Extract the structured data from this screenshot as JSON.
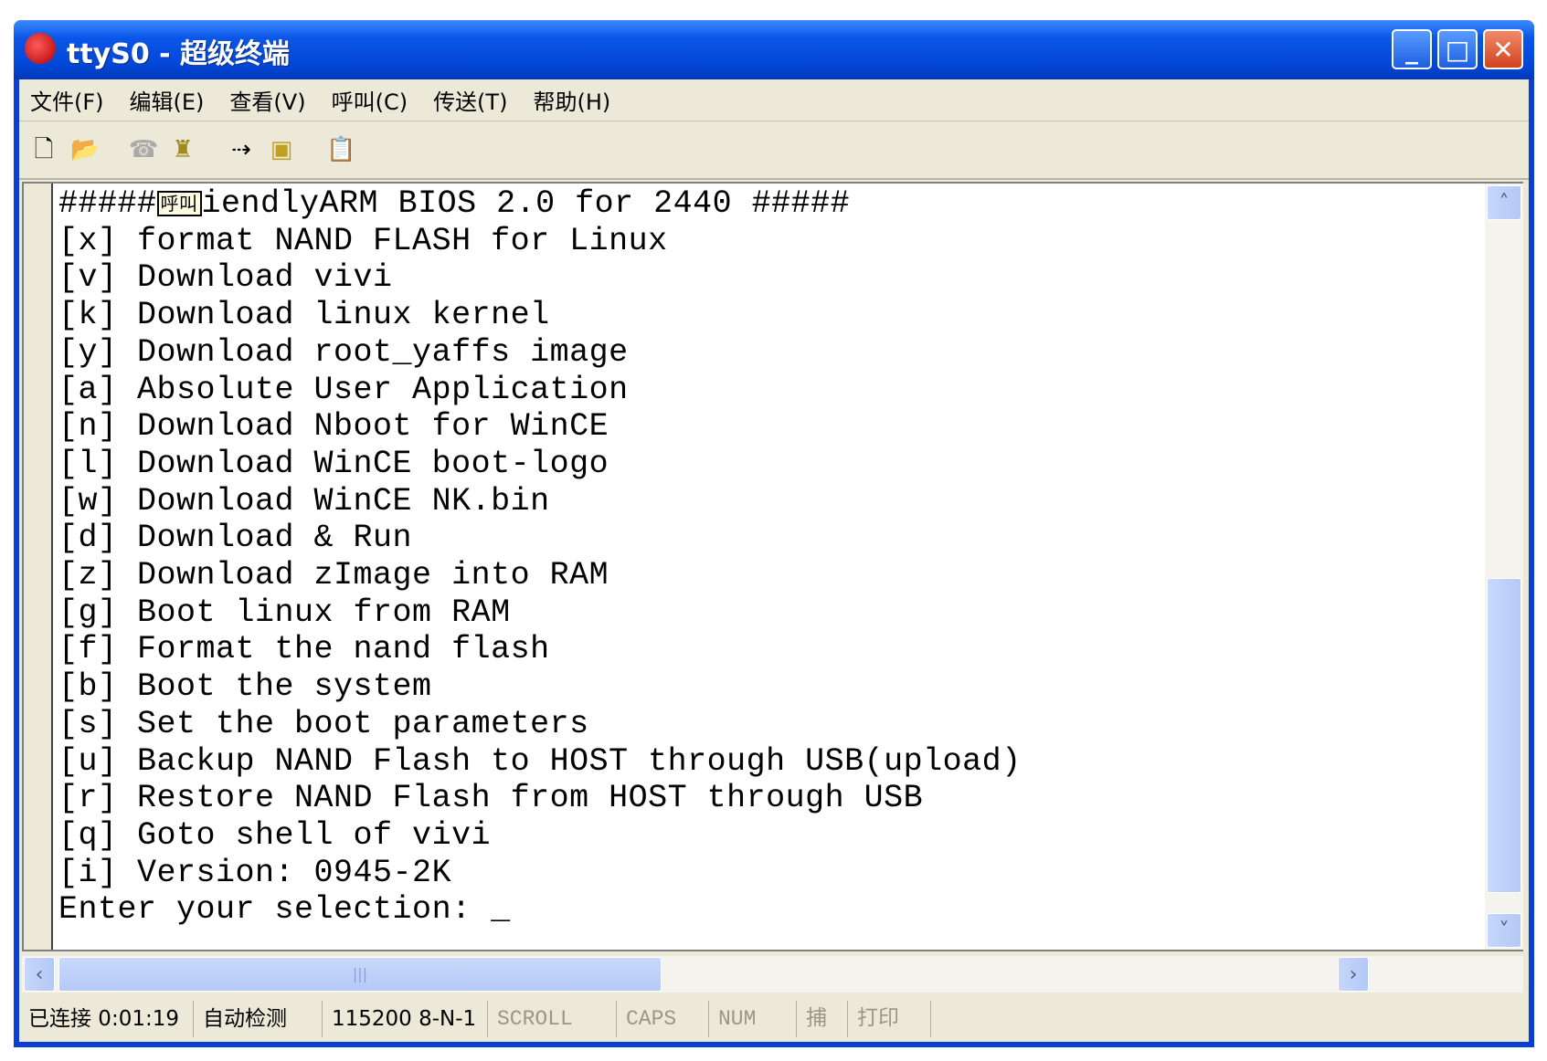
{
  "window": {
    "title": "ttyS0 - 超级终端"
  },
  "menu": [
    "文件(F)",
    "编辑(E)",
    "查看(V)",
    "呼叫(C)",
    "传送(T)",
    "帮助(H)"
  ],
  "toolbar": {
    "icons": [
      "new-file-icon",
      "open-folder-icon",
      "call-icon",
      "disconnect-icon",
      "send-icon",
      "receive-icon",
      "properties-icon"
    ]
  },
  "terminal": {
    "first_line_prefix": "#####",
    "overlay_label": "呼叫",
    "first_line_suffix": "iendlyARM BIOS 2.0 for 2440 #####",
    "lines": [
      "[x] format NAND FLASH for Linux",
      "[v] Download vivi",
      "[k] Download linux kernel",
      "[y] Download root_yaffs image",
      "[a] Absolute User Application",
      "[n] Download Nboot for WinCE",
      "[l] Download WinCE boot-logo",
      "[w] Download WinCE NK.bin",
      "[d] Download & Run",
      "[z] Download zImage into RAM",
      "[g] Boot linux from RAM",
      "[f] Format the nand flash",
      "[b] Boot the system",
      "[s] Set the boot parameters",
      "[u] Backup NAND Flash to HOST through USB(upload)",
      "[r] Restore NAND Flash from HOST through USB",
      "[q] Goto shell of vivi",
      "[i] Version: 0945-2K",
      "Enter your selection: _"
    ]
  },
  "status": {
    "connection": "已连接 0:01:19",
    "detect": "自动检测",
    "port": "115200 8-N-1",
    "scroll": "SCROLL",
    "caps": "CAPS",
    "num": "NUM",
    "capture": "捕",
    "print": "打印"
  }
}
